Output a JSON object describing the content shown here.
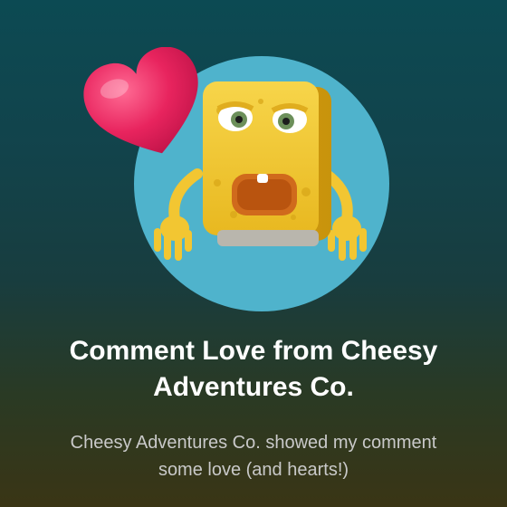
{
  "notification": {
    "title": "Comment Love from Cheesy Adventures Co.",
    "message": "Cheesy Adventures Co. showed my comment some love (and hearts!)"
  },
  "avatar": {
    "icon": "cheese-character-avatar",
    "background_color": "#4fb3cc"
  },
  "badge": {
    "icon": "heart-icon",
    "color": "#e8245e"
  },
  "colors": {
    "title_text": "#ffffff",
    "body_text": "#c9c9c9"
  }
}
